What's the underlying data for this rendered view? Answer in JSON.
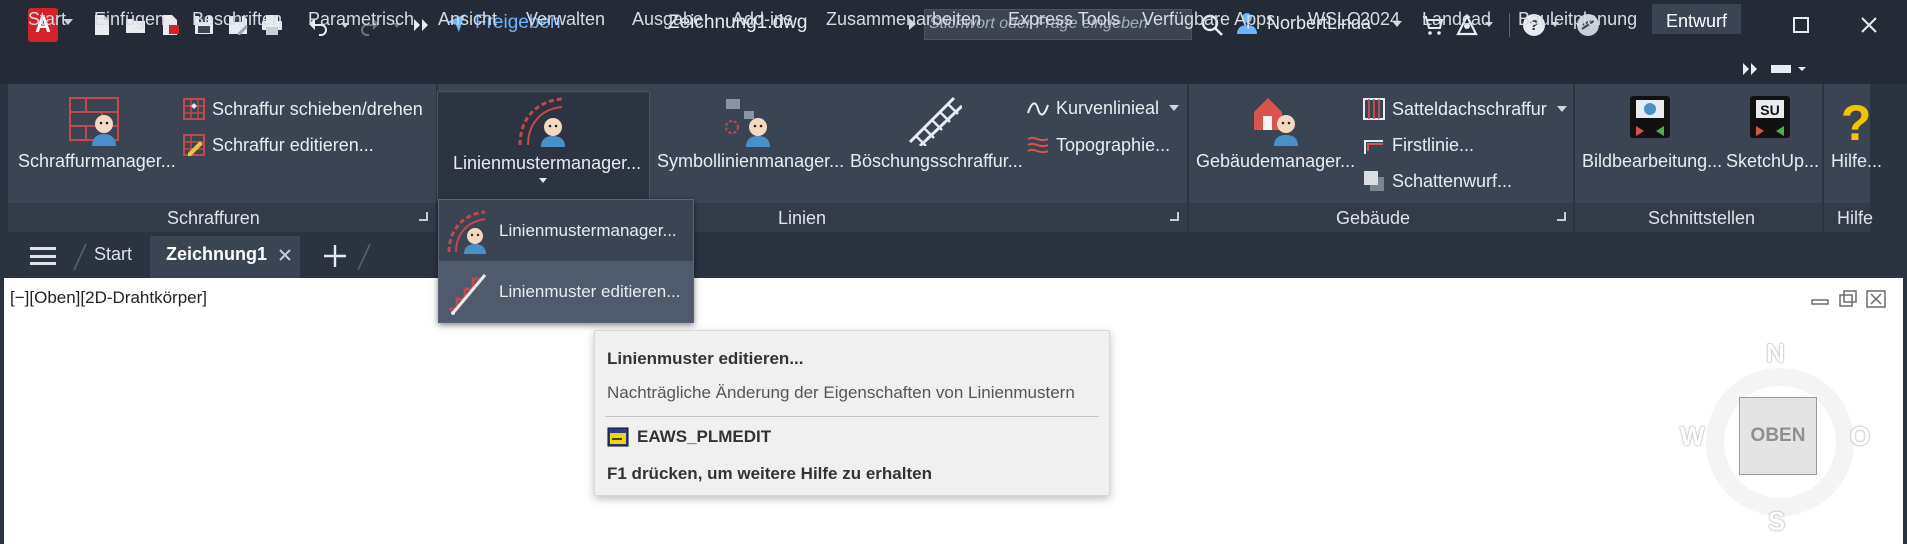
{
  "app": {
    "logo_letter": "A",
    "share_label": "Freigeben",
    "document_title": "Zeichnung1.dwg",
    "search_placeholder": "Stichwort oder Frage eingeben",
    "user_name": "NorbertLinda",
    "accent_color": "#6cb4ff",
    "brand_color": "#d6212b"
  },
  "tabs": [
    {
      "label": "Start"
    },
    {
      "label": "Einfügen"
    },
    {
      "label": "Beschriften"
    },
    {
      "label": "Parametrisch"
    },
    {
      "label": "Ansicht"
    },
    {
      "label": "Verwalten"
    },
    {
      "label": "Ausgabe"
    },
    {
      "label": "Add-ins"
    },
    {
      "label": "Zusammenarbeiten"
    },
    {
      "label": "Express Tools"
    },
    {
      "label": "Verfügbare Apps"
    },
    {
      "label": "WSLC2024"
    },
    {
      "label": "Landcad"
    },
    {
      "label": "Bauleitplanung"
    },
    {
      "label": "Entwurf",
      "active": true
    }
  ],
  "ribbon": {
    "schraffuren": {
      "title": "Schraffuren",
      "big": "Schraffurmanager...",
      "small1": "Schraffur schieben/drehen",
      "small2": "Schraffur editieren..."
    },
    "linien": {
      "title": "Linien",
      "big1": "Linienmustermanager...",
      "big2": "Symbollinienmanager...",
      "big3": "Böschungsschraffur...",
      "small1": "Kurvenlinieal",
      "small2": "Topographie..."
    },
    "gebaeude": {
      "title": "Gebäude",
      "big": "Gebäudemanager...",
      "small1": "Satteldachschraffur",
      "small2": "Firstlinie...",
      "small3": "Schattenwurf..."
    },
    "schnittstellen": {
      "title": "Schnittstellen",
      "big1": "Bildbearbeitung...",
      "big2": "SketchUp...",
      "sketchup_badge": "SU"
    },
    "hilfe": {
      "title": "Hilfe",
      "big": "Hilfe..."
    }
  },
  "doc_tabs": {
    "start": "Start",
    "active": "Zeichnung1"
  },
  "viewport": {
    "label": "[−][Oben][2D-Drahtkörper]"
  },
  "dropdown": {
    "item1": "Linienmustermanager...",
    "item2": "Linienmuster editieren..."
  },
  "tooltip": {
    "title": "Linienmuster editieren...",
    "description": "Nachträgliche Änderung der Eigenschaften von Linienmustern",
    "command": "EAWS_PLMEDIT",
    "help": "F1 drücken, um weitere Hilfe zu erhalten"
  },
  "viewcube": {
    "face": "OBEN",
    "north": "N",
    "south": "S",
    "east": "O",
    "west": "W"
  }
}
